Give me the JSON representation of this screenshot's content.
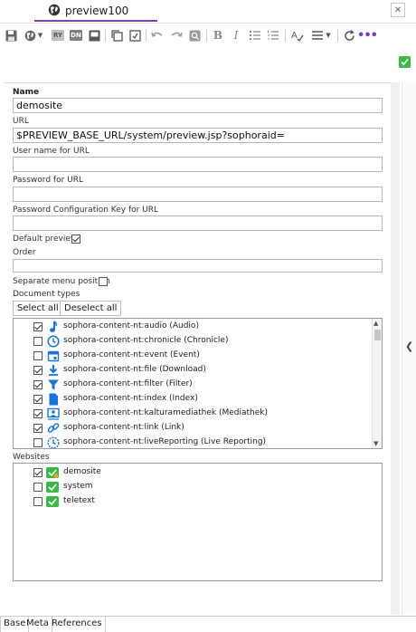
{
  "tab": {
    "title": "preview100",
    "icon": "globe-icon"
  },
  "toolbar": {
    "buttons": [
      "save-icon",
      "globe-dropdown-icon",
      "ry-icon",
      "dn-icon",
      "copy-icon",
      "paste-icon",
      "inbox-icon",
      "undo-icon",
      "redo-icon",
      "find-icon",
      "bold-icon",
      "italic-icon",
      "bullet-list-icon",
      "numbered-list-icon",
      "spellcheck-icon",
      "align-icon",
      "refresh-icon",
      "more-icon"
    ],
    "ry_label": "RY",
    "dn_label": "DN"
  },
  "form": {
    "name_label": "Name",
    "name_value": "demosite",
    "url_label": "URL",
    "url_value": "$PREVIEW_BASE_URL/system/preview.jsp?sophoraid=",
    "username_label": "User name for URL",
    "password_label": "Password for URL",
    "pwconfig_label": "Password Configuration Key for URL",
    "default_preview_label": "Default preview",
    "order_label": "Order",
    "separate_menu_label": "Separate menu position",
    "doc_types_label": "Document types",
    "select_all": "Select all",
    "deselect_all": "Deselect all",
    "websites_label": "Websites"
  },
  "document_types": [
    {
      "label": "sophora-content-nt:audio (Audio)",
      "checked": true,
      "icon": "music-note-icon"
    },
    {
      "label": "sophora-content-nt:chronicle (Chronicle)",
      "checked": false,
      "icon": "clock-icon"
    },
    {
      "label": "sophora-content-nt:event (Event)",
      "checked": false,
      "icon": "calendar-icon"
    },
    {
      "label": "sophora-content-nt:file (Download)",
      "checked": true,
      "icon": "download-icon"
    },
    {
      "label": "sophora-content-nt:filter (Filter)",
      "checked": true,
      "icon": "filter-icon"
    },
    {
      "label": "sophora-content-nt:index (Index)",
      "checked": true,
      "icon": "document-icon"
    },
    {
      "label": "sophora-content-nt:kalturamediathek (Mediathek)",
      "checked": true,
      "icon": "media-icon"
    },
    {
      "label": "sophora-content-nt:link (Link)",
      "checked": true,
      "icon": "link-icon"
    },
    {
      "label": "sophora-content-nt:liveReporting (Live Reporting)",
      "checked": false,
      "icon": "live-clock-icon"
    }
  ],
  "websites": [
    {
      "label": "demosite",
      "checked": true
    },
    {
      "label": "system",
      "checked": false
    },
    {
      "label": "teletext",
      "checked": false
    }
  ],
  "bottom_tabs": [
    "Base",
    "Meta",
    "References"
  ],
  "colors": {
    "accent": "#7a3fb5",
    "icon_blue": "#1a73d9",
    "status_green": "#3cb84a"
  }
}
